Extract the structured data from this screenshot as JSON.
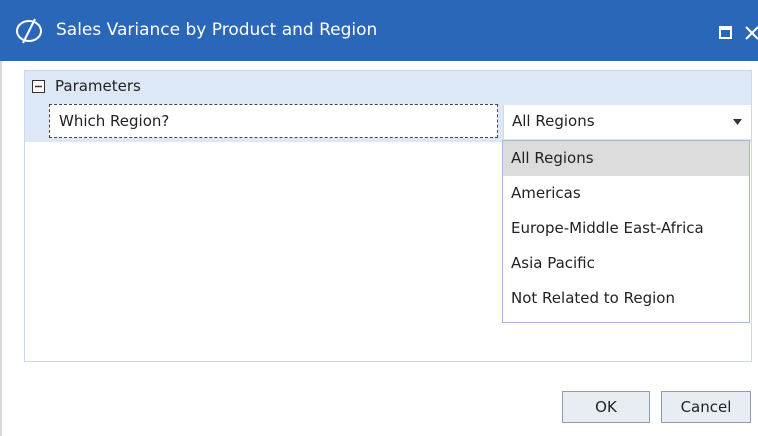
{
  "window": {
    "title": "Sales Variance by Product and Region",
    "accent_color": "#2b67b8",
    "logo_icon": "app-logo-icon",
    "maximize_icon": "maximize-icon",
    "close_icon": "close-icon"
  },
  "parameters": {
    "header_label": "Parameters",
    "collapse_icon": "collapse-minus-icon",
    "region_param": {
      "label": "Which Region?",
      "selected_value": "All Regions",
      "options": [
        "All Regions",
        "Americas",
        "Europe-Middle East-Africa",
        "Asia Pacific",
        "Not Related to Region"
      ]
    }
  },
  "buttons": {
    "ok_label": "OK",
    "cancel_label": "Cancel"
  }
}
